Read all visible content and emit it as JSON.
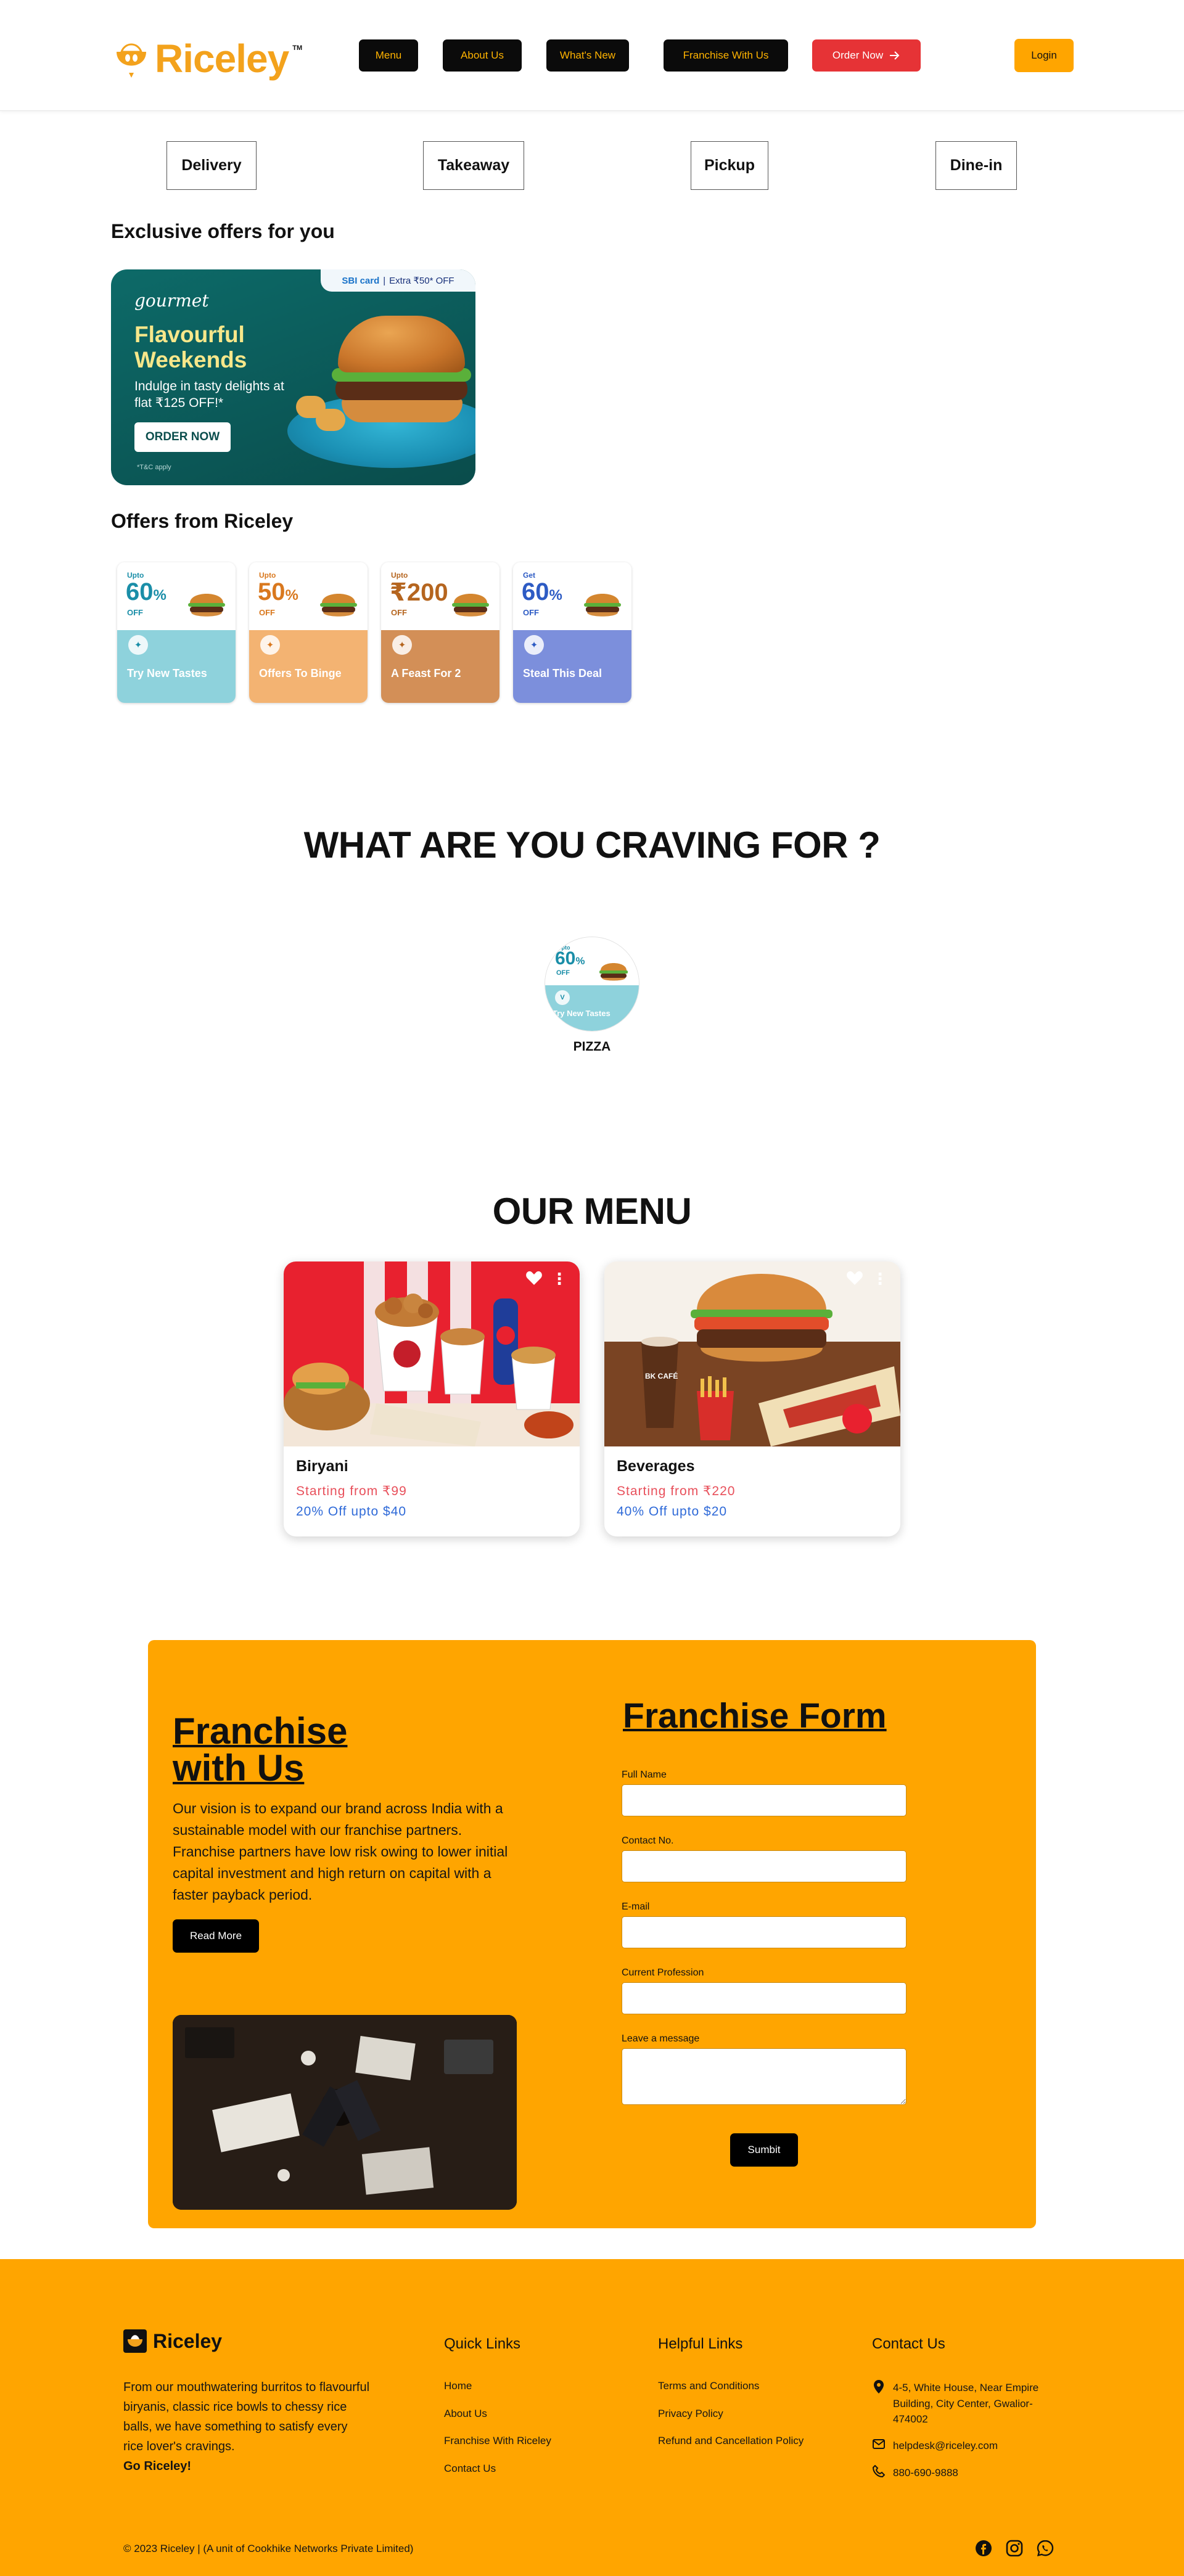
{
  "header": {
    "brand": "Riceley",
    "trademark": "TM",
    "nav": [
      {
        "label": "Menu"
      },
      {
        "label": "About Us"
      },
      {
        "label": "What's New"
      },
      {
        "label": "Franchise With Us"
      }
    ],
    "order_now": "Order Now",
    "login": "Login"
  },
  "order_types": [
    "Delivery",
    "Takeaway",
    "Pickup",
    "Dine-in"
  ],
  "exclusive": {
    "heading": "Exclusive offers for you",
    "banner": {
      "brand": "gourmet",
      "card_partner": "SBI card",
      "card_offer": "Extra ₹50* OFF",
      "title": "Flavourful Weekends",
      "description": "Indulge in tasty delights at flat ₹125 OFF!*",
      "button": "ORDER NOW",
      "terms": "*T&C apply"
    }
  },
  "riceley_offers": {
    "heading": "Offers from Riceley",
    "cards": [
      {
        "prefix": "Upto",
        "amount": "60",
        "unit": "%",
        "suffix": "OFF",
        "label": "Try New Tastes",
        "color": "#1a8ea8",
        "bottom": "#8ed2dc"
      },
      {
        "prefix": "Upto",
        "amount": "50",
        "unit": "%",
        "suffix": "OFF",
        "label": "Offers To Binge",
        "color": "#d9781e",
        "bottom": "#f3b372"
      },
      {
        "prefix": "Upto",
        "amount": "₹200",
        "unit": "",
        "suffix": "OFF",
        "label": "A Feast For 2",
        "color": "#b5651f",
        "bottom": "#d38f57"
      },
      {
        "prefix": "Get",
        "amount": "60",
        "unit": "%",
        "suffix": "OFF",
        "label": "Steal This Deal",
        "color": "#2d5bc4",
        "bottom": "#7c8fdc"
      }
    ]
  },
  "craving": {
    "title": "WHAT ARE YOU CRAVING FOR ?",
    "items": [
      {
        "label": "PIZZA",
        "prefix": "Upto",
        "amount": "60",
        "unit": "%",
        "suffix": "OFF",
        "caption": "Try New Tastes"
      }
    ]
  },
  "menu": {
    "title": "OUR MENU",
    "items": [
      {
        "name": "Biryani",
        "price": "Starting from ₹99",
        "discount": "20% Off upto $40"
      },
      {
        "name": "Beverages",
        "price": "Starting from ₹220",
        "discount": "40% Off upto $20"
      }
    ]
  },
  "franchise": {
    "title": "Franchise with Us",
    "title_line1": "Franchise",
    "title_line2": "with Us",
    "text": "Our vision is to expand our brand across India with a sustainable model with our franchise partners. Franchise partners have low risk owing to lower initial capital investment and high return on capital with a faster payback period.",
    "read_more": "Read More",
    "form": {
      "title": "Franchise Form",
      "fields": [
        {
          "label": "Full Name"
        },
        {
          "label": "Contact No."
        },
        {
          "label": "E-mail"
        },
        {
          "label": "Current Profession"
        },
        {
          "label": "Leave a message"
        }
      ],
      "submit": "Sumbit"
    }
  },
  "footer": {
    "brand": "Riceley",
    "about": "From our mouthwatering burritos to flavourful biryanis, classic rice bowls to chessy rice balls, we have something to satisfy every rice lover's cravings.",
    "tagline": "Go Riceley!",
    "quick_links": {
      "heading": "Quick Links",
      "items": [
        "Home",
        "About Us",
        "Franchise With Riceley",
        "Contact Us"
      ]
    },
    "helpful_links": {
      "heading": "Helpful Links",
      "items": [
        "Terms and Conditions",
        "Privacy Policy",
        "Refund and Cancellation Policy"
      ]
    },
    "contact": {
      "heading": "Contact Us",
      "address": "4-5, White House, Near Empire Building, City Center, Gwalior-474002",
      "email": "helpdesk@riceley.com",
      "phone": "880-690-9888"
    },
    "copyright": "© 2023 Riceley | (A unit of Cookhike Networks Private Limited)",
    "social": [
      "facebook-icon",
      "instagram-icon",
      "whatsapp-icon"
    ]
  },
  "colors": {
    "brand_orange": "#ffa500",
    "nav_bg": "#0b0b0b",
    "nav_text": "#ffb300",
    "order_red": "#e63336",
    "price_red": "#e8505b",
    "discount_blue": "#2f6ad8"
  }
}
